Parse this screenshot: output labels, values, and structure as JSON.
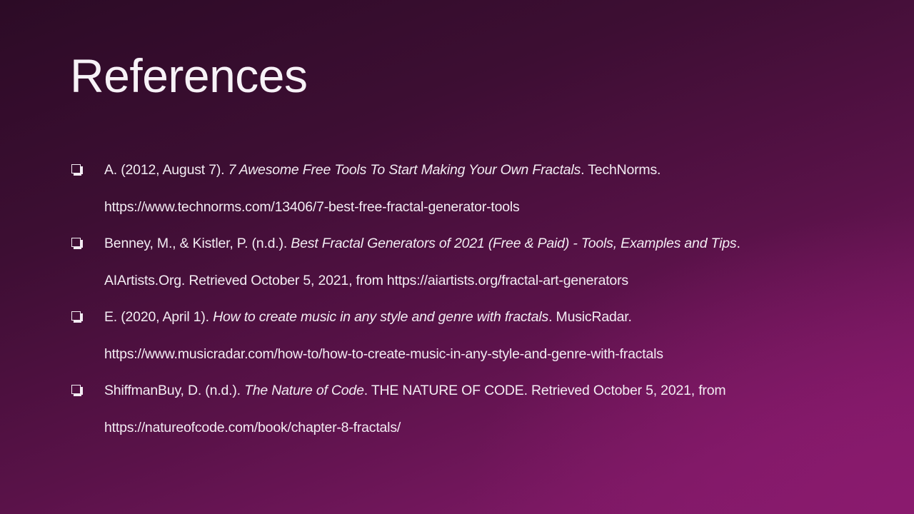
{
  "slide": {
    "title": "References",
    "references": [
      {
        "prefix": "A. (2012, August 7). ",
        "italic": "7 Awesome Free Tools To Start Making Your Own Fractals",
        "suffix": ". TechNorms.",
        "line2": "https://www.technorms.com/13406/7-best-free-fractal-generator-tools"
      },
      {
        "prefix": "Benney, M., & Kistler, P. (n.d.). ",
        "italic": "Best Fractal Generators of 2021 (Free & Paid) - Tools, Examples and Tips",
        "suffix": ".",
        "line2": "AIArtists.Org. Retrieved October 5, 2021, from https://aiartists.org/fractal-art-generators"
      },
      {
        "prefix": "E. (2020, April 1). ",
        "italic": "How to create music in any style and genre with fractals",
        "suffix": ". MusicRadar.",
        "line2": "https://www.musicradar.com/how-to/how-to-create-music-in-any-style-and-genre-with-fractals"
      },
      {
        "prefix": "ShiffmanBuy, D. (n.d.). ",
        "italic": "The Nature of Code",
        "suffix": ". THE NATURE OF CODE. Retrieved October 5, 2021, from",
        "line2": "https://natureofcode.com/book/chapter-8-fractals/"
      }
    ]
  }
}
